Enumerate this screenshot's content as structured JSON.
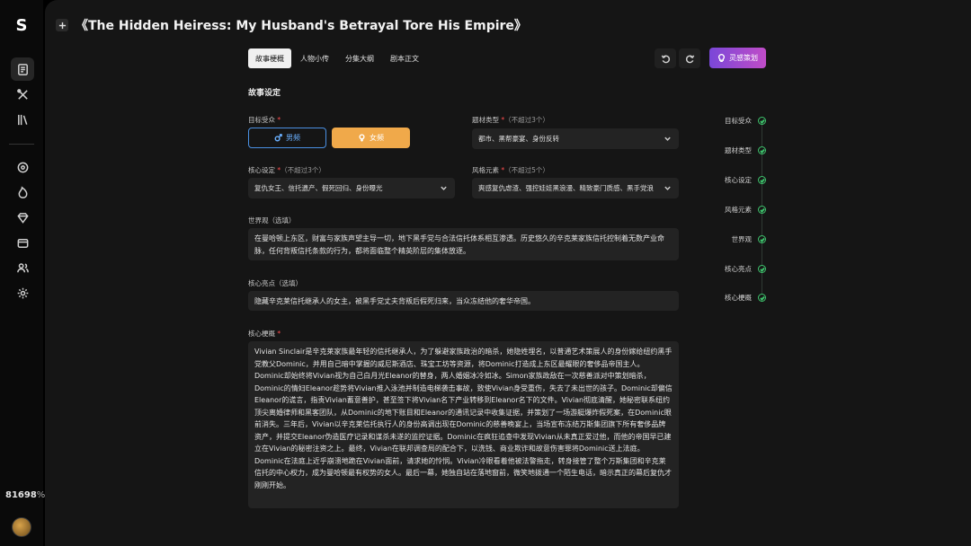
{
  "app": {
    "logo": "S",
    "credits": "81698"
  },
  "header": {
    "title": "《The Hidden Heiress: My Husband's Betrayal Tore His Empire》"
  },
  "tabs": [
    {
      "label": "故事梗概"
    },
    {
      "label": "人物小传"
    },
    {
      "label": "分集大纲"
    },
    {
      "label": "剧本正文"
    }
  ],
  "toolbar": {
    "inspire_label": "灵感策划"
  },
  "section": {
    "title": "故事设定"
  },
  "fields": {
    "audience": {
      "label": "目标受众",
      "male": "男频",
      "female": "女频",
      "selected": "女频"
    },
    "genre": {
      "label": "题材类型",
      "hint": "（不超过3个）",
      "value": "都市、黑帮豪宴、身份反转"
    },
    "core_setting": {
      "label": "核心设定",
      "hint": "（不超过3个）",
      "value": "复仇女王、信托遗产、假死回归、身份曝光"
    },
    "style": {
      "label": "风格元素",
      "hint": "（不超过5个）",
      "value": "爽感复仇虐渣、强控娃娃黑浪漫、精致豪门质感、黑手党浪"
    },
    "worldview": {
      "label": "世界观（选填）",
      "value": "在曼哈顿上东区，财富与家族声望主导一切，地下黑手党与合法信托体系相互渗透。历史悠久的辛克莱家族信托控制着无数产业命脉，任何背叛信托条款的行为，都将面临整个精英阶层的集体放逐。"
    },
    "highlight": {
      "label": "核心亮点（选填）",
      "value": "隐藏辛克莱信托继承人的女主，被黑手党丈夫背叛后假死归来，当众冻结他的奢华帝国。"
    },
    "synopsis": {
      "label": "核心梗概",
      "value": "Vivian Sinclair是辛克莱家族最年轻的信托继承人，为了躲避家族政治的暗杀，她隐姓埋名，以普通艺术策展人的身份嫁给纽约黑手党教父Dominic，并用自己暗中掌握的威尼斯酒店、珠宝工坊等资源，将Dominic打造成上东区最耀眼的奢侈品帝国主人。Dominic却始终将Vivian视为自己白月光Eleanor的替身，两人婚姻冰冷如冰。Simon家族政敌在一次慈善派对中策划暗杀，Dominic的情妇Eleanor趁势将Vivian推入泳池并制造电梯袭击事故，致使Vivian身受重伤，失去了未出世的孩子。Dominic却偏信Eleanor的谎言，指责Vivian蓄意善护，甚至签下将Vivian名下产业转移到Eleanor名下的文件。Vivian彻底清醒，她秘密联系纽约顶尖离婚律师和黑客团队，从Dominic的地下账目和Eleanor的通讯记录中收集证据，并策划了一场游艇爆炸假死案，在Dominic眼前消失。三年后，Vivian以辛克莱信托执行人的身份高调出现在Dominic的慈善晚宴上，当场宣布冻结万斯集团旗下所有奢侈品牌资产，并提交Eleanor伪造医疗记录和谋杀未遂的监控证据。Dominic在疯狂追查中发现Vivian从未真正爱过他，而他的帝国早已建立在Vivian的秘密注资之上。最终，Vivian在联邦调查局的配合下，以洗钱、商业欺诈和故意伤害罪将Dominic送上法庭。Dominic在法庭上近乎崩溃地跪在Vivian面前，请求她的怜悯。Vivian冷眼看着他被法警拖走，转身接管了整个万斯集团和辛克莱信托的中心权力，成为曼哈顿最有权势的女人。最后一幕，她独自站在落地窗前，微笑地拨通一个陌生电话，暗示真正的幕后复仇才刚刚开始。"
    }
  },
  "steps": [
    {
      "label": "目标受众"
    },
    {
      "label": "题材类型"
    },
    {
      "label": "核心设定"
    },
    {
      "label": "风格元素"
    },
    {
      "label": "世界观"
    },
    {
      "label": "核心亮点"
    },
    {
      "label": "核心梗概"
    }
  ],
  "colors": {
    "accent_orange": "#f0a94a",
    "accent_blue": "#4a90e2",
    "success_green": "#3ec46d",
    "required_red": "#ff4d4f"
  }
}
